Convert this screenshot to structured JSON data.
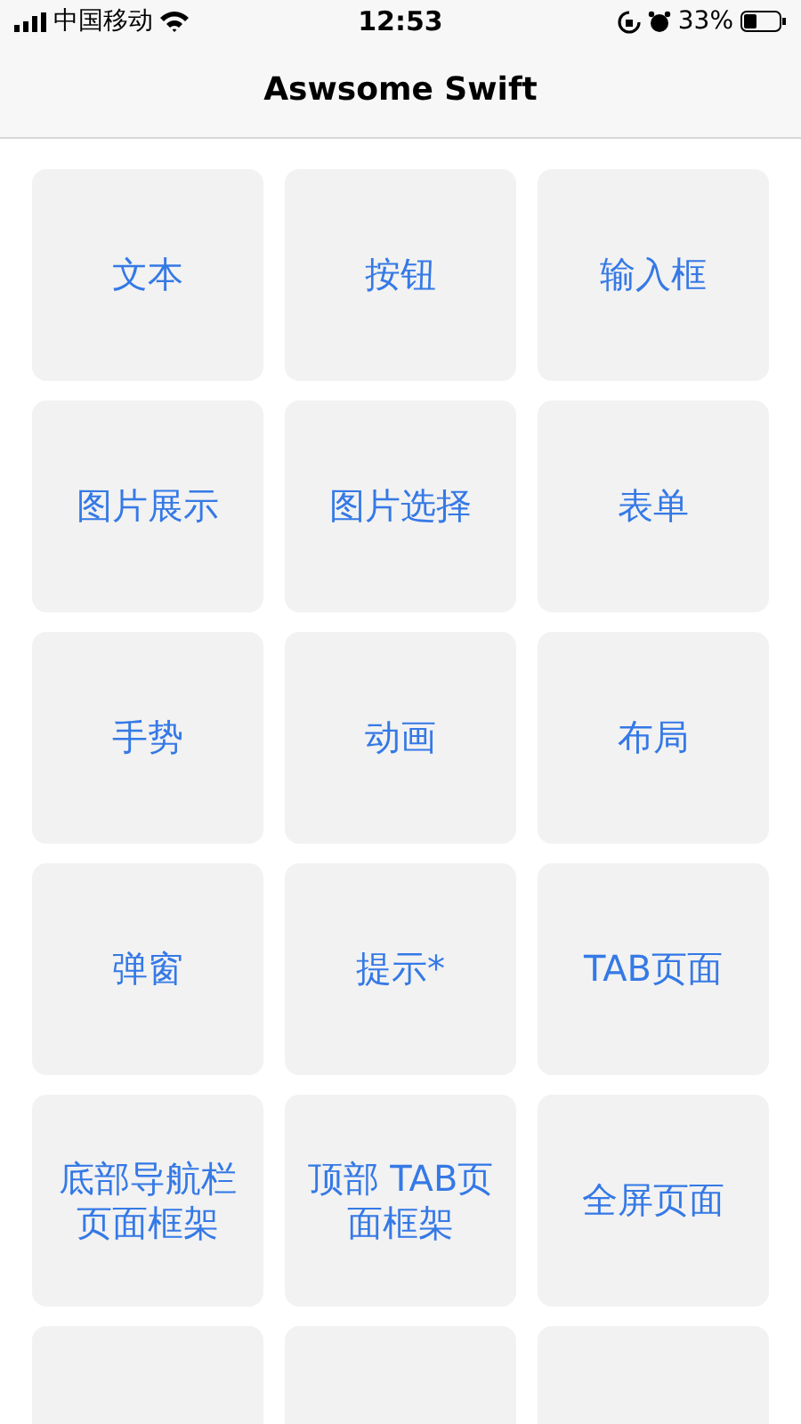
{
  "status_bar": {
    "carrier": "中国移动",
    "time": "12:53",
    "battery": "33%"
  },
  "nav_bar": {
    "title": "Aswsome Swift"
  },
  "tiles": [
    {
      "kind": "labeled",
      "label": "文本"
    },
    {
      "kind": "labeled",
      "label": "按钮"
    },
    {
      "kind": "labeled",
      "label": "输入框"
    },
    {
      "kind": "labeled",
      "label": "图片展示"
    },
    {
      "kind": "labeled",
      "label": "图片选择"
    },
    {
      "kind": "labeled",
      "label": "表单"
    },
    {
      "kind": "labeled",
      "label": "手势"
    },
    {
      "kind": "labeled",
      "label": "动画"
    },
    {
      "kind": "labeled",
      "label": "布局"
    },
    {
      "kind": "labeled",
      "label": "弹窗"
    },
    {
      "kind": "labeled",
      "label": "提示*"
    },
    {
      "kind": "labeled",
      "label": "TAB页面"
    },
    {
      "kind": "labeled",
      "label": "底部导航栏页面框架"
    },
    {
      "kind": "labeled",
      "label": "顶部 TAB页面框架"
    },
    {
      "kind": "labeled",
      "label": "全屏页面"
    },
    {
      "kind": "cut"
    },
    {
      "kind": "cut"
    },
    {
      "kind": "cut"
    }
  ]
}
